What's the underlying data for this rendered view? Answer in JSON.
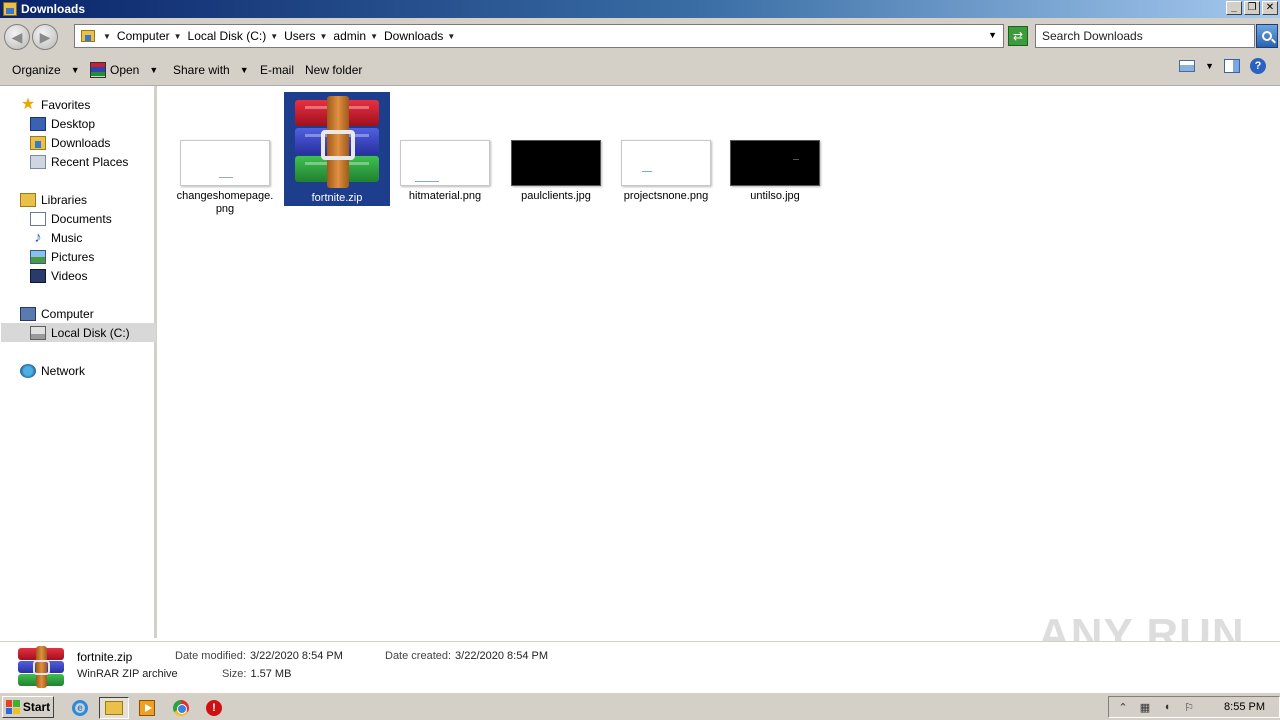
{
  "window": {
    "title": "Downloads"
  },
  "address": {
    "crumbs": [
      "Computer",
      "Local Disk (C:)",
      "Users",
      "admin",
      "Downloads"
    ],
    "search_placeholder": "Search Downloads"
  },
  "toolbar": {
    "organize": "Organize",
    "open": "Open",
    "share_with": "Share with",
    "email": "E-mail",
    "new_folder": "New folder"
  },
  "nav": {
    "favorites": "Favorites",
    "desktop": "Desktop",
    "downloads": "Downloads",
    "recent_places": "Recent Places",
    "libraries": "Libraries",
    "documents": "Documents",
    "music": "Music",
    "pictures": "Pictures",
    "videos": "Videos",
    "computer": "Computer",
    "local_disk": "Local Disk (C:)",
    "network": "Network"
  },
  "files": [
    {
      "name": "changeshomepage.png",
      "line1": "changeshomepage.",
      "line2": "png",
      "thumb": "white"
    },
    {
      "name": "fortnite.zip",
      "line1": "fortnite.zip",
      "line2": "",
      "thumb": "winrar",
      "selected": true
    },
    {
      "name": "hitmaterial.png",
      "line1": "hitmaterial.png",
      "line2": "",
      "thumb": "white"
    },
    {
      "name": "paulclients.jpg",
      "line1": "paulclients.jpg",
      "line2": "",
      "thumb": "black"
    },
    {
      "name": "projectsnone.png",
      "line1": "projectsnone.png",
      "line2": "",
      "thumb": "white"
    },
    {
      "name": "untilso.jpg",
      "line1": "untilso.jpg",
      "line2": "",
      "thumb": "black"
    }
  ],
  "details": {
    "name": "fortnite.zip",
    "type": "WinRAR ZIP archive",
    "date_modified_label": "Date modified:",
    "date_modified": "3/22/2020 8:54 PM",
    "date_created_label": "Date created:",
    "date_created": "3/22/2020 8:54 PM",
    "size_label": "Size:",
    "size": "1.57 MB"
  },
  "watermark": "ANY RUN",
  "taskbar": {
    "start": "Start",
    "clock": "8:55 PM"
  }
}
